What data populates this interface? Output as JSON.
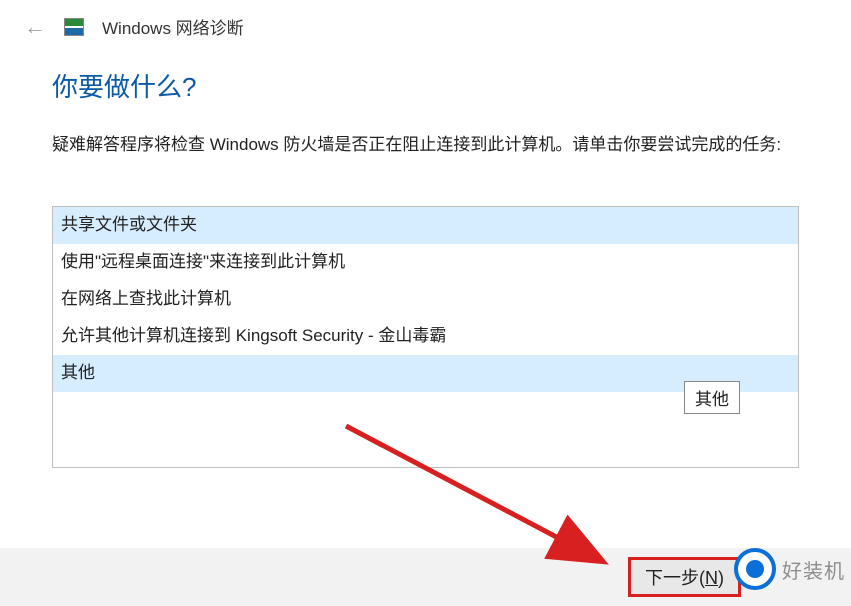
{
  "header": {
    "title": "Windows 网络诊断"
  },
  "main": {
    "question": "你要做什么?",
    "description": "疑难解答程序将检查 Windows 防火墙是否正在阻止连接到此计算机。请单击你要尝试完成的任务:",
    "options": [
      {
        "label": "共享文件或文件夹",
        "selected": true
      },
      {
        "label": "使用\"远程桌面连接\"来连接到此计算机",
        "selected": false
      },
      {
        "label": "在网络上查找此计算机",
        "selected": false
      },
      {
        "label": "允许其他计算机连接到 Kingsoft Security - 金山毒霸",
        "selected": false
      },
      {
        "label": "其他",
        "selected": true
      }
    ],
    "tooltip": "其他"
  },
  "footer": {
    "next_label_prefix": "下一步(",
    "next_label_key": "N",
    "next_label_suffix": ")"
  },
  "watermark": {
    "text": "好装机"
  }
}
